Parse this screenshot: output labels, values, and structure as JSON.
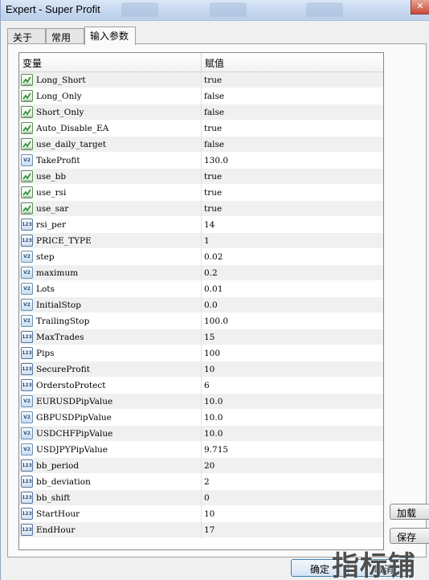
{
  "window": {
    "title": "Expert - Super Profit",
    "close_glyph": "✕"
  },
  "tabs": [
    {
      "label": "关于"
    },
    {
      "label": "常用"
    },
    {
      "label": "输入参数"
    }
  ],
  "grid": {
    "headers": {
      "name": "变量",
      "value": "赋值"
    },
    "rows": [
      {
        "name": "Long_Short",
        "value": "true",
        "type": "bool"
      },
      {
        "name": "Long_Only",
        "value": "false",
        "type": "bool"
      },
      {
        "name": "Short_Only",
        "value": "false",
        "type": "bool"
      },
      {
        "name": "Auto_Disable_EA",
        "value": "true",
        "type": "bool"
      },
      {
        "name": "use_daily_target",
        "value": "false",
        "type": "bool"
      },
      {
        "name": "TakeProfit",
        "value": "130.0",
        "type": "double"
      },
      {
        "name": "use_bb",
        "value": "true",
        "type": "bool"
      },
      {
        "name": "use_rsi",
        "value": "true",
        "type": "bool"
      },
      {
        "name": "use_sar",
        "value": "true",
        "type": "bool"
      },
      {
        "name": "rsi_per",
        "value": "14",
        "type": "int"
      },
      {
        "name": "PRICE_TYPE",
        "value": "1",
        "type": "int"
      },
      {
        "name": "step",
        "value": "0.02",
        "type": "double"
      },
      {
        "name": "maximum",
        "value": "0.2",
        "type": "double"
      },
      {
        "name": "Lots",
        "value": "0.01",
        "type": "double"
      },
      {
        "name": "InitialStop",
        "value": "0.0",
        "type": "double"
      },
      {
        "name": "TrailingStop",
        "value": "100.0",
        "type": "double"
      },
      {
        "name": "MaxTrades",
        "value": "15",
        "type": "int"
      },
      {
        "name": "Pips",
        "value": "100",
        "type": "int"
      },
      {
        "name": "SecureProfit",
        "value": "10",
        "type": "int"
      },
      {
        "name": "OrderstoProtect",
        "value": "6",
        "type": "int"
      },
      {
        "name": "EURUSDPipValue",
        "value": "10.0",
        "type": "double"
      },
      {
        "name": "GBPUSDPipValue",
        "value": "10.0",
        "type": "double"
      },
      {
        "name": "USDCHFPipValue",
        "value": "10.0",
        "type": "double"
      },
      {
        "name": "USDJPYPipValue",
        "value": "9.715",
        "type": "double"
      },
      {
        "name": "bb_period",
        "value": "20",
        "type": "int"
      },
      {
        "name": "bb_deviation",
        "value": "2",
        "type": "int"
      },
      {
        "name": "bb_shift",
        "value": "0",
        "type": "int"
      },
      {
        "name": "StartHour",
        "value": "10",
        "type": "int"
      },
      {
        "name": "EndHour",
        "value": "17",
        "type": "int"
      }
    ]
  },
  "icons": {
    "bool": "bool-type-icon",
    "double": "double-type-icon",
    "int": "int-type-icon"
  },
  "icon_text": {
    "double": "V2",
    "int": "123"
  },
  "side_buttons": {
    "load": "加载",
    "save": "保存"
  },
  "bottom_buttons": {
    "ok": "确定",
    "cancel": "取消"
  },
  "watermark": "指标铺"
}
